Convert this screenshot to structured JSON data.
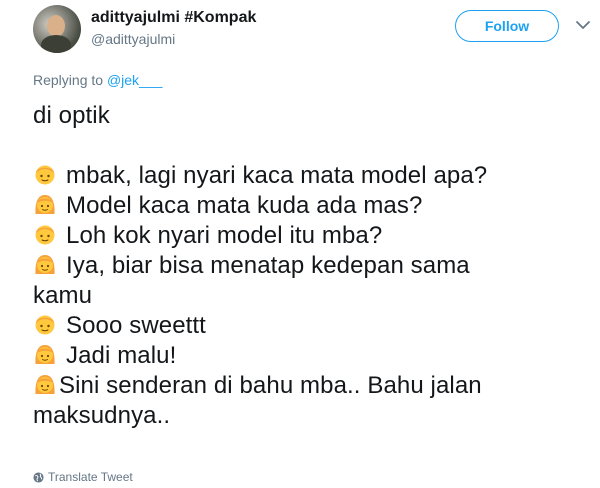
{
  "tweet": {
    "author_name": "adittyajulmi #Kompak",
    "author_handle": "@adittyajulmi",
    "follow_label": "Follow",
    "replying_to_label": "Replying to",
    "replying_to_handle": "@jek___",
    "lines": [
      {
        "icon": "",
        "text": "di optik"
      },
      {
        "icon": "boy-emoji-icon",
        "text": "mbak, lagi nyari kaca mata model apa?"
      },
      {
        "icon": "girl-emoji-icon",
        "text": "Model kaca mata kuda ada mas?"
      },
      {
        "icon": "boy-emoji-icon",
        "text": "Loh kok nyari model itu mba?"
      },
      {
        "icon": "girl-emoji-icon",
        "text": "Iya, biar bisa menatap kedepan sama"
      },
      {
        "icon": "",
        "text": "kamu"
      },
      {
        "icon": "boy-emoji-icon",
        "text": "Sooo sweettt"
      },
      {
        "icon": "girl-emoji-icon",
        "text": "Jadi malu!"
      },
      {
        "icon": "girl-emoji-icon",
        "text": "Sini senderan di bahu mba.. Bahu jalan"
      },
      {
        "icon": "",
        "text": "maksudnya.."
      }
    ],
    "translate_label": "Translate Tweet"
  },
  "colors": {
    "accent": "#1da1f2",
    "text": "#14171a",
    "muted": "#657786",
    "emoji_face": "#ffc83d",
    "emoji_hair": "#f7a13b"
  }
}
